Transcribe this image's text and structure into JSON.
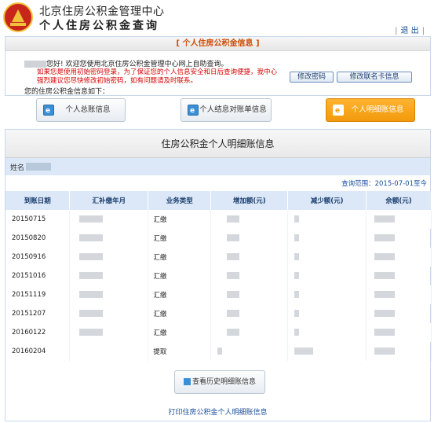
{
  "header": {
    "title_line1": "北京住房公积金管理中心",
    "title_line2": "个人住房公积金查询",
    "logout": "退 出"
  },
  "info": {
    "title": "[ 个人住房公积金信息 ]",
    "welcome": "您好! 欢迎您使用北京住房公积金管理中心网上自助查询。",
    "notice": "如果您是使用初始密码登录，为了保证您的个人信息安全和日后查询便捷，我中心强烈建议您尽快修改初始密码，如有问题请及时联系。",
    "info_label": "您的住房公积金信息如下：",
    "btn_change_pwd": "修改密码",
    "btn_change_card": "修改联名卡信息"
  },
  "tabs": [
    {
      "label": "个人总账信息",
      "active": false
    },
    {
      "label": "个人结息对账单信息",
      "active": false
    },
    {
      "label": "个人明细账信息",
      "active": true
    }
  ],
  "panel": {
    "title": "住房公积金个人明细账信息",
    "name_label": "姓名",
    "range_label": "查询范围：",
    "range_value": "2015-07-01至今",
    "columns": [
      "到账日期",
      "汇补缴年月",
      "业务类型",
      "增加额(元)",
      "减少额(元)",
      "余额(元)"
    ],
    "rows": [
      {
        "date": "20150715",
        "type": "汇缴"
      },
      {
        "date": "20150820",
        "type": "汇缴"
      },
      {
        "date": "20150916",
        "type": "汇缴"
      },
      {
        "date": "20151016",
        "type": "汇缴"
      },
      {
        "date": "20151119",
        "type": "汇缴"
      },
      {
        "date": "20151207",
        "type": "汇缴"
      },
      {
        "date": "20160122",
        "type": "汇缴"
      },
      {
        "date": "20160204",
        "type": "提取"
      }
    ],
    "history_button": "查看历史明细账信息",
    "print_link": "打印住房公积金个人明细账信息"
  },
  "colors": {
    "accent_orange": "#f29a0c",
    "header_blue": "#dce8f7",
    "notice_red": "#d60000",
    "link_blue": "#1a4f9c"
  }
}
